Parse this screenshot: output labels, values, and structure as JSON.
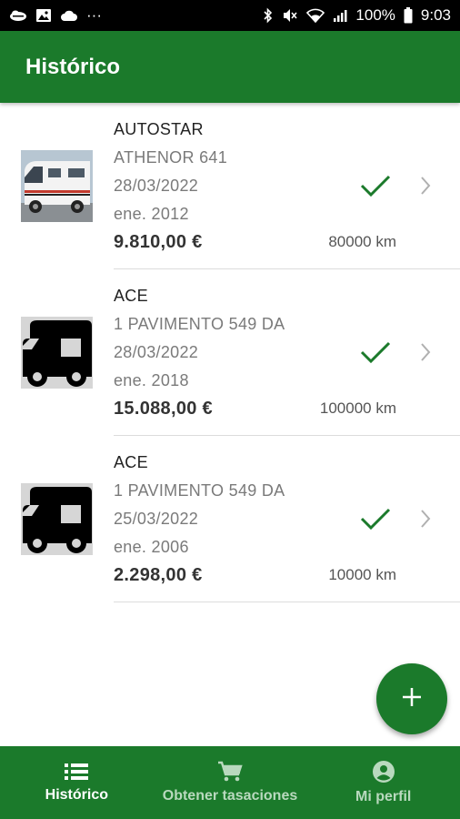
{
  "status_bar": {
    "battery": "100%",
    "time": "9:03",
    "dots": "···",
    "icons": [
      "cloud-weather-icon",
      "gallery-icon",
      "cloud-icon",
      "bluetooth-icon",
      "mute-icon",
      "wifi-icon",
      "signal-icon",
      "battery-icon"
    ]
  },
  "header": {
    "title": "Histórico"
  },
  "items": [
    {
      "brand": "AUTOSTAR",
      "model": "ATHENOR 641",
      "date": "28/03/2022",
      "registration": "ene. 2012",
      "price": "9.810,00 €",
      "km": "80000 km",
      "thumbnail": "camper-photo",
      "status": "check-icon"
    },
    {
      "brand": "ACE",
      "model": "1 PAVIMENTO 549 DA",
      "date": "28/03/2022",
      "registration": "ene. 2018",
      "price": "15.088,00 €",
      "km": "100000 km",
      "thumbnail": "motorhome-icon",
      "status": "check-icon"
    },
    {
      "brand": "ACE",
      "model": "1 PAVIMENTO 549 DA",
      "date": "25/03/2022",
      "registration": "ene. 2006",
      "price": "2.298,00 €",
      "km": "10000 km",
      "thumbnail": "motorhome-icon",
      "status": "check-icon"
    }
  ],
  "fab": {
    "icon": "plus-icon"
  },
  "bottom_nav": {
    "items": [
      {
        "label": "Histórico",
        "icon": "list-icon",
        "active": true
      },
      {
        "label": "Obtener tasaciones",
        "icon": "cart-icon",
        "active": false
      },
      {
        "label": "Mi perfil",
        "icon": "account-circle-icon",
        "active": false
      }
    ]
  },
  "colors": {
    "primary": "#1b7a2b",
    "check": "#1b7a2b",
    "status_bar": "#000000"
  }
}
